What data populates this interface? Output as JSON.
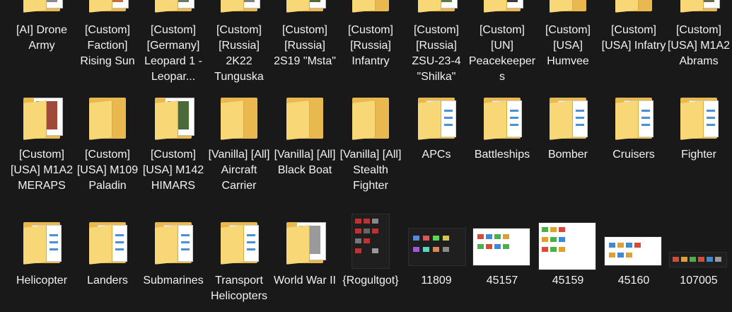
{
  "colors": {
    "background": "#191919",
    "text": "#f2f2f2",
    "folder_back": "#e9b94f",
    "folder_front": "#f8d776",
    "paper_line": "#4b8fd6"
  },
  "items": [
    {
      "name": "[AI] Drone Army",
      "icon": "folder-thumb-icon"
    },
    {
      "name": "[Custom] Faction] Rising Sun",
      "icon": "folder-thumb-icon"
    },
    {
      "name": "[Custom] [Germany] Leopard 1 - Leopar...",
      "icon": "folder-thumb-icon"
    },
    {
      "name": "[Custom] [Russia] 2K22 Tunguska",
      "icon": "folder-thumb-icon"
    },
    {
      "name": "[Custom] [Russia] 2S19 \"Msta\"",
      "icon": "folder-thumb-icon"
    },
    {
      "name": "[Custom] [Russia] Infantry",
      "icon": "folder-icon"
    },
    {
      "name": "[Custom] [Russia] ZSU-23-4 \"Shilka\"",
      "icon": "folder-thumb-icon"
    },
    {
      "name": "[Custom] [UN] Peacekeepers",
      "icon": "folder-thumb-icon"
    },
    {
      "name": "[Custom] [USA] Humvee",
      "icon": "folder-icon"
    },
    {
      "name": "[Custom] [USA] Infatry",
      "icon": "folder-icon"
    },
    {
      "name": "[Custom] [USA] M1A2 Abrams",
      "icon": "folder-thumb-icon"
    },
    {
      "name": "[Custom] [USA] M1A2 MERAPS",
      "icon": "folder-thumb-icon"
    },
    {
      "name": "[Custom] [USA] M109 Paladin",
      "icon": "folder-icon"
    },
    {
      "name": "[Custom] [USA] M142 HIMARS",
      "icon": "folder-thumb-icon"
    },
    {
      "name": "[Vanilla] [All] Aircraft Carrier",
      "icon": "folder-icon"
    },
    {
      "name": "[Vanilla] [All] Black Boat",
      "icon": "folder-icon"
    },
    {
      "name": "[Vanilla] [All] Stealth Fighter",
      "icon": "folder-icon"
    },
    {
      "name": "APCs",
      "icon": "folder-papers-icon"
    },
    {
      "name": "Battleships",
      "icon": "folder-papers-icon"
    },
    {
      "name": "Bomber",
      "icon": "folder-papers-icon"
    },
    {
      "name": "Cruisers",
      "icon": "folder-papers-icon"
    },
    {
      "name": "Fighter",
      "icon": "folder-papers-icon"
    },
    {
      "name": "Helicopter",
      "icon": "folder-papers-icon"
    },
    {
      "name": "Landers",
      "icon": "folder-papers-icon"
    },
    {
      "name": "Submarines",
      "icon": "folder-papers-icon"
    },
    {
      "name": "Transport Helicopters",
      "icon": "folder-papers-icon"
    },
    {
      "name": "World War II",
      "icon": "folder-thumb-icon"
    },
    {
      "name": "{Rogultgot}",
      "icon": "image-file-icon"
    },
    {
      "name": "11809",
      "icon": "image-file-icon"
    },
    {
      "name": "45157",
      "icon": "image-file-icon"
    },
    {
      "name": "45159",
      "icon": "image-file-icon"
    },
    {
      "name": "45160",
      "icon": "image-file-icon"
    },
    {
      "name": "107005",
      "icon": "image-file-icon"
    }
  ]
}
